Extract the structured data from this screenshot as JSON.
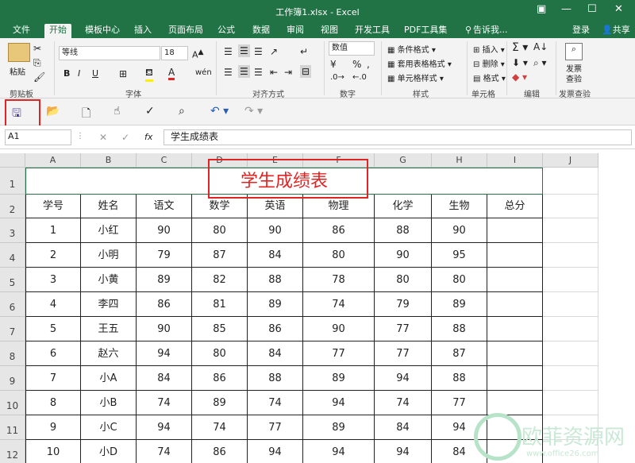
{
  "titlebar": {
    "title": "工作簿1.xlsx - Excel"
  },
  "tabs": [
    "文件",
    "开始",
    "模板中心",
    "插入",
    "页面布局",
    "公式",
    "数据",
    "审阅",
    "视图",
    "开发工具",
    "PDF工具集"
  ],
  "search_text": "告诉我...",
  "login_label": "登录",
  "share_label": "共享",
  "ribbon": {
    "paste_label": "粘贴",
    "clipboard_label": "剪贴板",
    "font_name": "等线",
    "font_size": "18",
    "font_label": "字体",
    "align_label": "对齐方式",
    "number_format": "数值",
    "number_label": "数字",
    "cond_format": "条件格式",
    "table_format": "套用表格格式",
    "cell_style": "单元格样式",
    "style_label": "样式",
    "insert_label": "插入",
    "delete_label": "删除",
    "format_label": "格式",
    "cells_label": "单元格",
    "edit_label": "编辑",
    "publish_check": "发票查验",
    "publish_line1": "发票",
    "publish_line2": "查验",
    "bold": "B",
    "italic": "I",
    "underline": "U"
  },
  "namebox": "A1",
  "formula": "学生成绩表",
  "columns": [
    "A",
    "B",
    "C",
    "D",
    "E",
    "F",
    "G",
    "H",
    "I",
    "J"
  ],
  "rows": [
    "1",
    "2",
    "3",
    "4",
    "5",
    "6",
    "7",
    "8",
    "9",
    "10",
    "11",
    "12"
  ],
  "sheet_title": "学生成绩表",
  "headers": [
    "学号",
    "姓名",
    "语文",
    "数学",
    "英语",
    "物理",
    "化学",
    "生物",
    "总分"
  ],
  "data_rows": [
    [
      "1",
      "小红",
      "90",
      "80",
      "90",
      "86",
      "88",
      "90",
      ""
    ],
    [
      "2",
      "小明",
      "79",
      "87",
      "84",
      "80",
      "90",
      "95",
      ""
    ],
    [
      "3",
      "小黄",
      "89",
      "82",
      "88",
      "78",
      "80",
      "80",
      ""
    ],
    [
      "4",
      "李四",
      "86",
      "81",
      "89",
      "74",
      "79",
      "89",
      ""
    ],
    [
      "5",
      "王五",
      "90",
      "85",
      "86",
      "90",
      "77",
      "88",
      ""
    ],
    [
      "6",
      "赵六",
      "94",
      "80",
      "84",
      "77",
      "77",
      "87",
      ""
    ],
    [
      "7",
      "小A",
      "84",
      "86",
      "88",
      "89",
      "94",
      "88",
      ""
    ],
    [
      "8",
      "小B",
      "74",
      "89",
      "74",
      "94",
      "74",
      "77",
      ""
    ],
    [
      "9",
      "小C",
      "94",
      "74",
      "77",
      "89",
      "84",
      "94",
      ""
    ],
    [
      "10",
      "小D",
      "74",
      "86",
      "94",
      "94",
      "94",
      "84",
      ""
    ]
  ],
  "watermark": {
    "text": "欧菲资源网",
    "url": "www.office26.com"
  },
  "colors": {
    "excel_green": "#217346",
    "highlight_red": "#e02424"
  }
}
